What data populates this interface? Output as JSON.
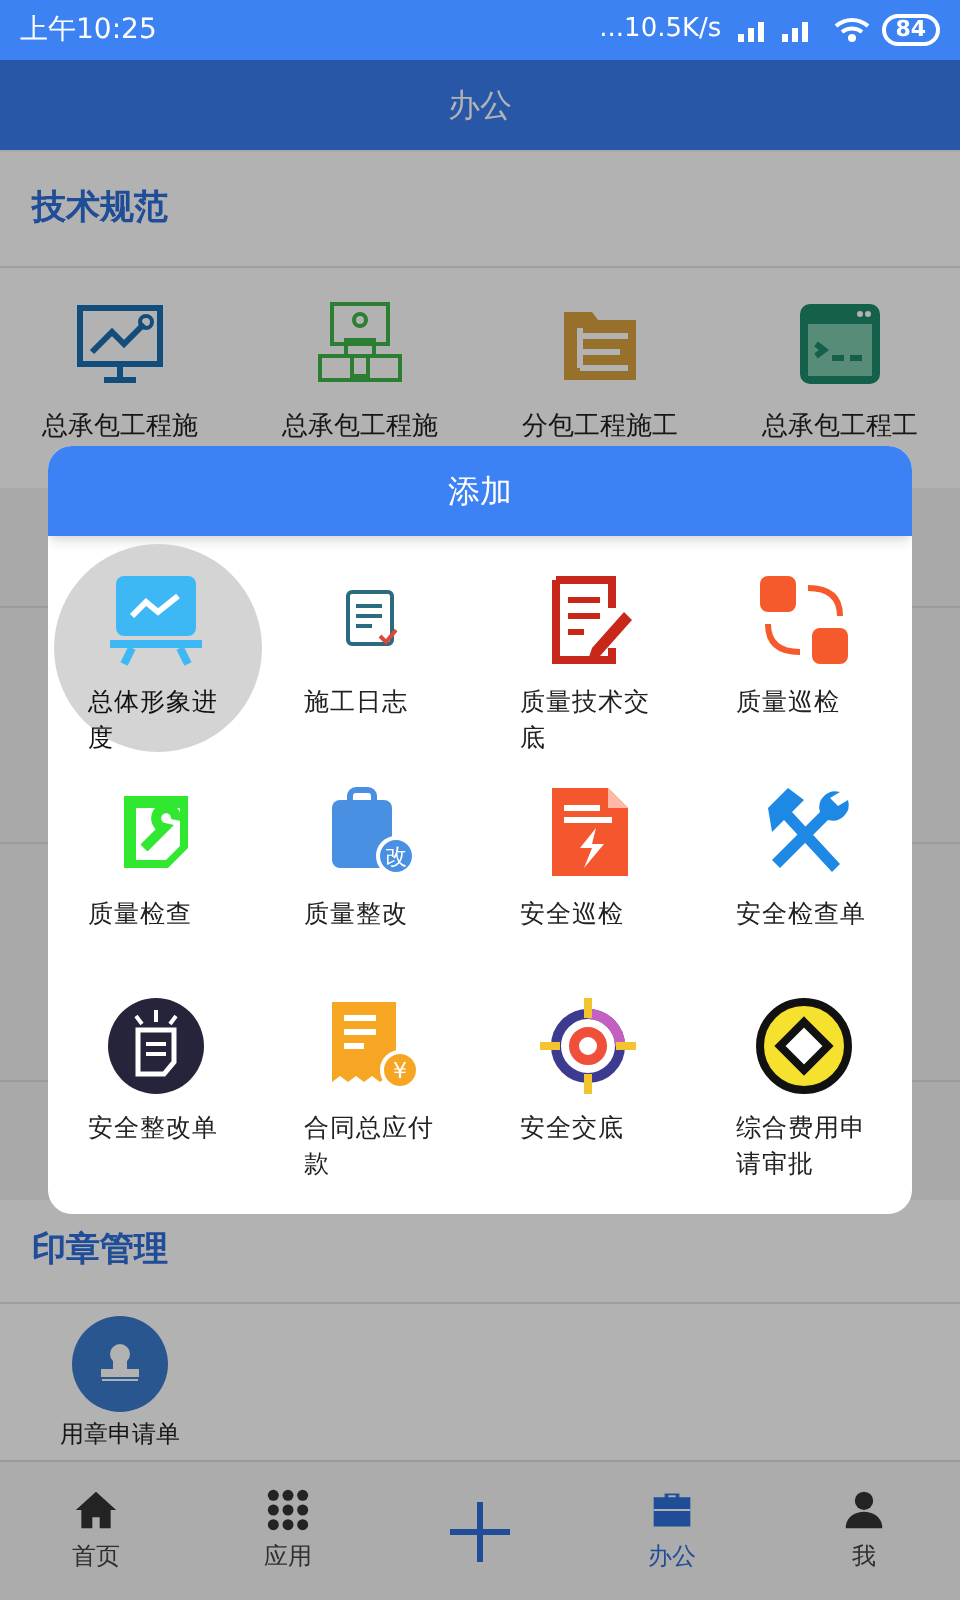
{
  "status_bar": {
    "time": "上午10:25",
    "speed": "...10.5K/s",
    "battery": "84"
  },
  "header": {
    "title": "办公"
  },
  "sections": [
    {
      "title": "技术规范",
      "items": [
        {
          "label": "总承包工程施"
        },
        {
          "label": "总承包工程施"
        },
        {
          "label": "分包工程施工"
        },
        {
          "label": "总承包工程工"
        }
      ]
    },
    {
      "title": "印章管理",
      "items": [
        {
          "label": "用章申请单"
        }
      ]
    }
  ],
  "dialog": {
    "title": "添加",
    "items": [
      {
        "label": "总体形象进度",
        "selected": true
      },
      {
        "label": "施工日志",
        "selected": false
      },
      {
        "label": "质量技术交底",
        "selected": false
      },
      {
        "label": "质量巡检",
        "selected": false
      },
      {
        "label": "质量检查",
        "selected": false
      },
      {
        "label": "质量整改",
        "selected": false,
        "badge": "改"
      },
      {
        "label": "安全巡检",
        "selected": false
      },
      {
        "label": "安全检查单",
        "selected": false
      },
      {
        "label": "安全整改单",
        "selected": false
      },
      {
        "label": "合同总应付款",
        "selected": false,
        "badge": "¥"
      },
      {
        "label": "安全交底",
        "selected": false
      },
      {
        "label": "综合费用申请审批",
        "selected": false
      }
    ]
  },
  "tab_bar": [
    {
      "kind": "tab",
      "label": "首页",
      "selected": false
    },
    {
      "kind": "tab",
      "label": "应用",
      "selected": false
    },
    {
      "kind": "add"
    },
    {
      "kind": "tab",
      "label": "办公",
      "selected": true
    },
    {
      "kind": "tab",
      "label": "我",
      "selected": false
    }
  ]
}
